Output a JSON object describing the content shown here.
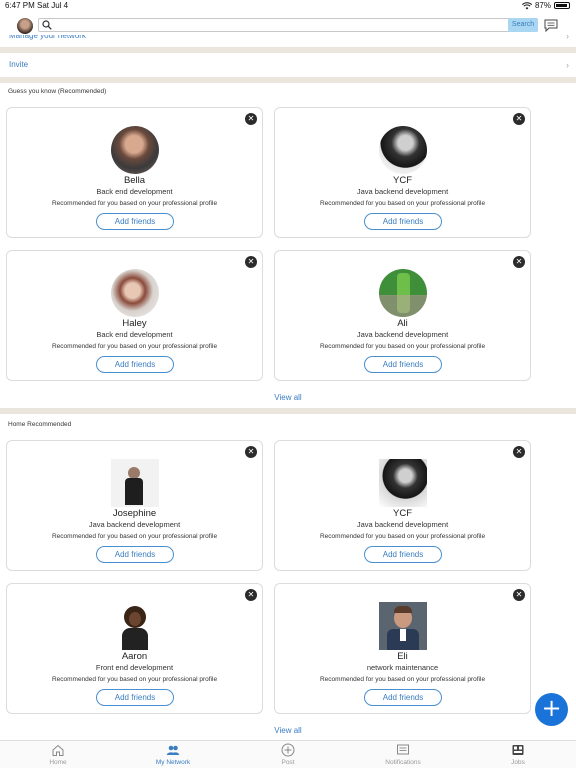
{
  "status_bar": {
    "time": "6:47 PM",
    "date": "Sat Jul 4",
    "battery": "87%"
  },
  "header": {
    "search_placeholder": "",
    "search_button": "Search"
  },
  "menu": {
    "manage_network": "Manage your network",
    "invite": "Invite",
    "chevron": "›"
  },
  "sections": [
    {
      "title": "Guess you know (Recommended)",
      "view_all": "View all",
      "cards": [
        {
          "name": "Bella",
          "role": "Back end development",
          "rec": "Recommended for you based on your professional profile",
          "button": "Add friends",
          "close": "✕"
        },
        {
          "name": "YCF",
          "role": "Java backend development",
          "rec": "Recommended for you based on your professional profile",
          "button": "Add friends",
          "close": "✕"
        },
        {
          "name": "Haley",
          "role": "Back end development",
          "rec": "Recommended for you based on your professional profile",
          "button": "Add friends",
          "close": "✕"
        },
        {
          "name": "Ali",
          "role": "Java backend development",
          "rec": "Recommended for you based on your professional profile",
          "button": "Add friends",
          "close": "✕"
        }
      ]
    },
    {
      "title": "Home Recommended",
      "view_all": "View all",
      "cards": [
        {
          "name": "Josephine",
          "role": "Java backend development",
          "rec": "Recommended for you based on your professional profile",
          "button": "Add friends",
          "close": "✕"
        },
        {
          "name": "YCF",
          "role": "Java backend development",
          "rec": "Recommended for you based on your professional profile",
          "button": "Add friends",
          "close": "✕"
        },
        {
          "name": "Aaron",
          "role": "Front end development",
          "rec": "Recommended for you based on your professional profile",
          "button": "Add friends",
          "close": "✕"
        },
        {
          "name": "Eli",
          "role": "network maintenance",
          "rec": "Recommended for you based on your professional profile",
          "button": "Add friends",
          "close": "✕"
        }
      ]
    }
  ],
  "fab": {
    "label": "+"
  },
  "tabs": [
    {
      "label": "Home",
      "icon": "home-icon"
    },
    {
      "label": "My Network",
      "icon": "people-icon",
      "active": true
    },
    {
      "label": "Post",
      "icon": "plus-circle-icon"
    },
    {
      "label": "Notifications",
      "icon": "message-icon"
    },
    {
      "label": "Jobs",
      "icon": "briefcase-icon"
    }
  ],
  "colors": {
    "accent": "#3a7dc1",
    "fab": "#1a73d9",
    "separator": "#ebe6dd"
  }
}
